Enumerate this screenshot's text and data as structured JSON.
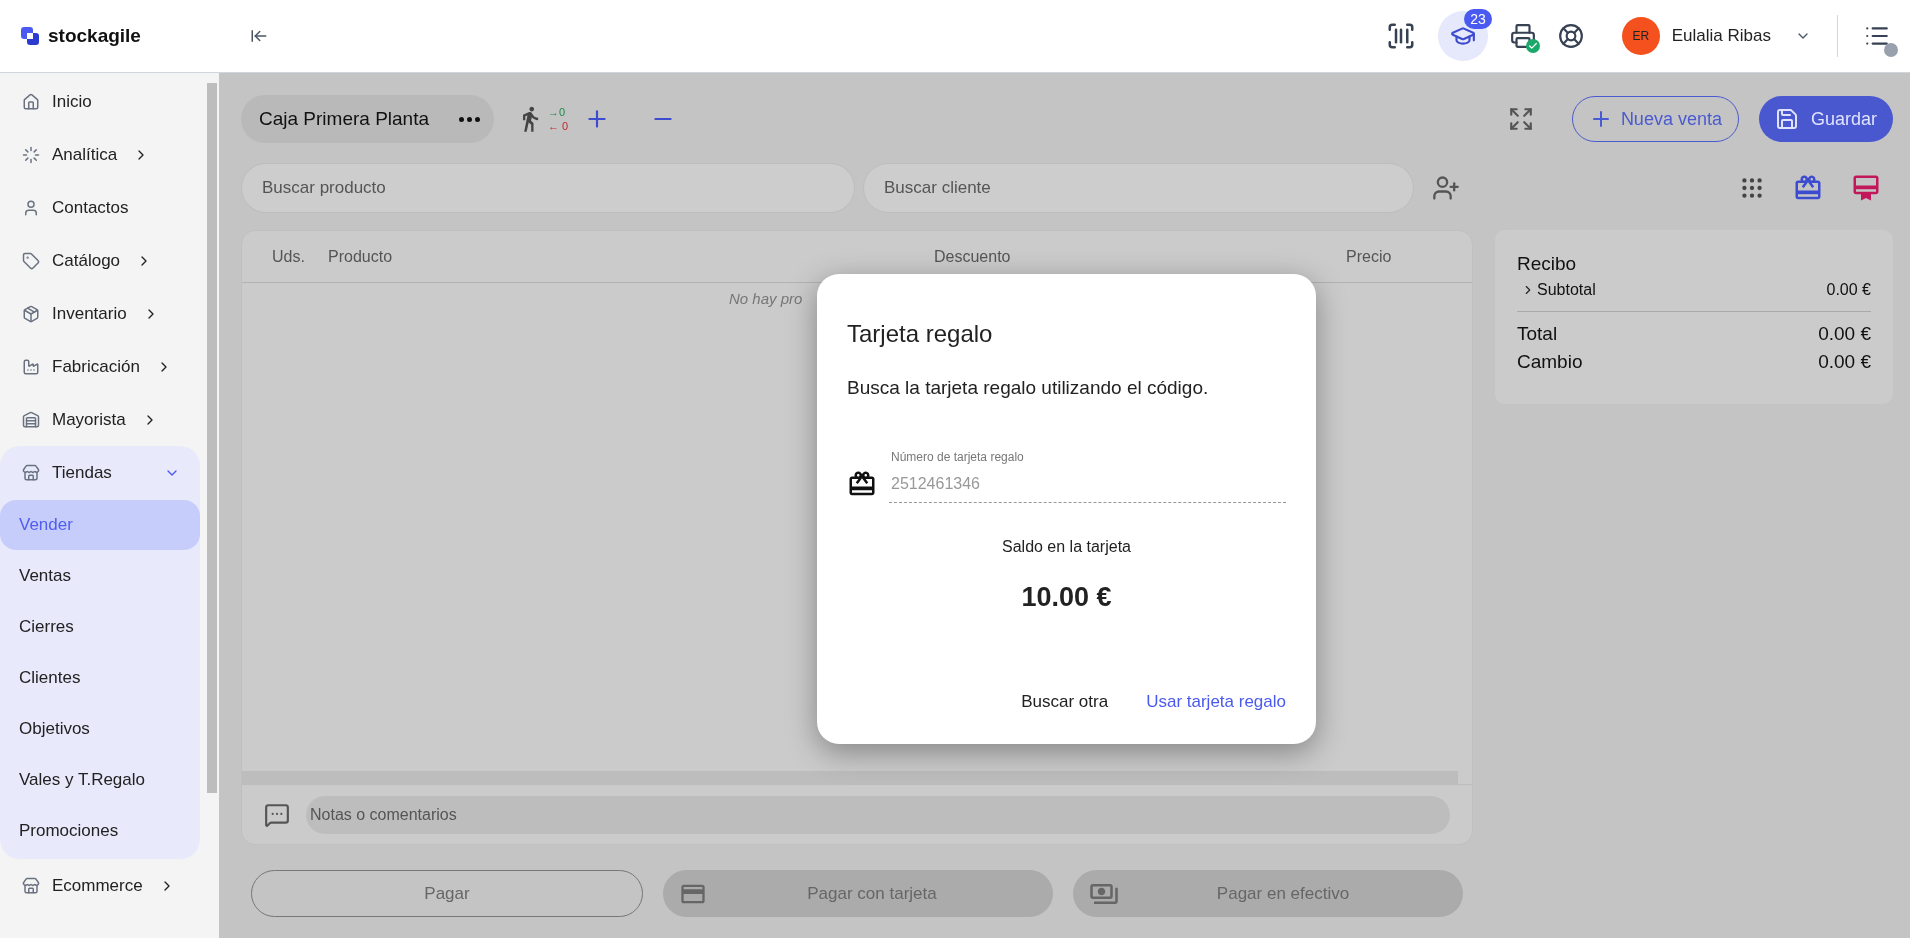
{
  "header": {
    "logo": "stockagile",
    "badge": "23",
    "user": {
      "initials": "ER",
      "name": "Eulalia Ribas"
    }
  },
  "sidebar": {
    "items": [
      {
        "label": "Inicio"
      },
      {
        "label": "Analítica",
        "expanded": false
      },
      {
        "label": "Contactos"
      },
      {
        "label": "Catálogo",
        "expanded": false
      },
      {
        "label": "Inventario",
        "expanded": false
      },
      {
        "label": "Fabricación",
        "expanded": false
      },
      {
        "label": "Mayorista",
        "expanded": false
      },
      {
        "label": "Tiendas",
        "expanded": true,
        "children": [
          {
            "label": "Vender",
            "selected": true
          },
          {
            "label": "Ventas",
            "selected": false
          },
          {
            "label": "Cierres",
            "selected": false
          },
          {
            "label": "Clientes",
            "selected": false
          },
          {
            "label": "Objetivos",
            "selected": false
          },
          {
            "label": "Vales y T.Regalo",
            "selected": false
          },
          {
            "label": "Promociones",
            "selected": false
          }
        ]
      },
      {
        "label": "Ecommerce",
        "expanded": false
      }
    ]
  },
  "toolbar": {
    "register": "Caja Primera Planta",
    "moves_in": "→0",
    "moves_out": "← 0",
    "new_sale": "Nueva venta",
    "save": "Guardar"
  },
  "search": {
    "product_placeholder": "Buscar producto",
    "client_placeholder": "Buscar cliente"
  },
  "table": {
    "columns": [
      "Uds.",
      "Producto",
      "Descuento",
      "Precio"
    ],
    "empty": "No hay pro"
  },
  "notes": {
    "placeholder": "Notas o comentarios"
  },
  "receipt": {
    "title": "Recibo",
    "lines": [
      {
        "label": "Subtotal",
        "value": "0.00 €",
        "kind": "expandable"
      },
      {
        "label": "Total",
        "value": "0.00 €",
        "kind": "total"
      },
      {
        "label": "Cambio",
        "value": "0.00 €",
        "kind": "total"
      }
    ]
  },
  "payment_buttons": [
    {
      "label": "Pagar",
      "kind": "outline"
    },
    {
      "label": "Pagar con tarjeta",
      "kind": "card"
    },
    {
      "label": "Pagar en efectivo",
      "kind": "cash"
    }
  ],
  "dialog": {
    "title": "Tarjeta regalo",
    "description": "Busca la tarjeta regalo utilizando el código.",
    "field": {
      "label": "Número de tarjeta regalo",
      "value": "2512461346",
      "disabled": true
    },
    "balance_label": "Saldo en la tarjeta",
    "balance": "10.00 €",
    "buttons": [
      {
        "label": "Buscar otra",
        "kind": "secondary"
      },
      {
        "label": "Usar tarjeta regalo",
        "kind": "primary"
      }
    ]
  }
}
